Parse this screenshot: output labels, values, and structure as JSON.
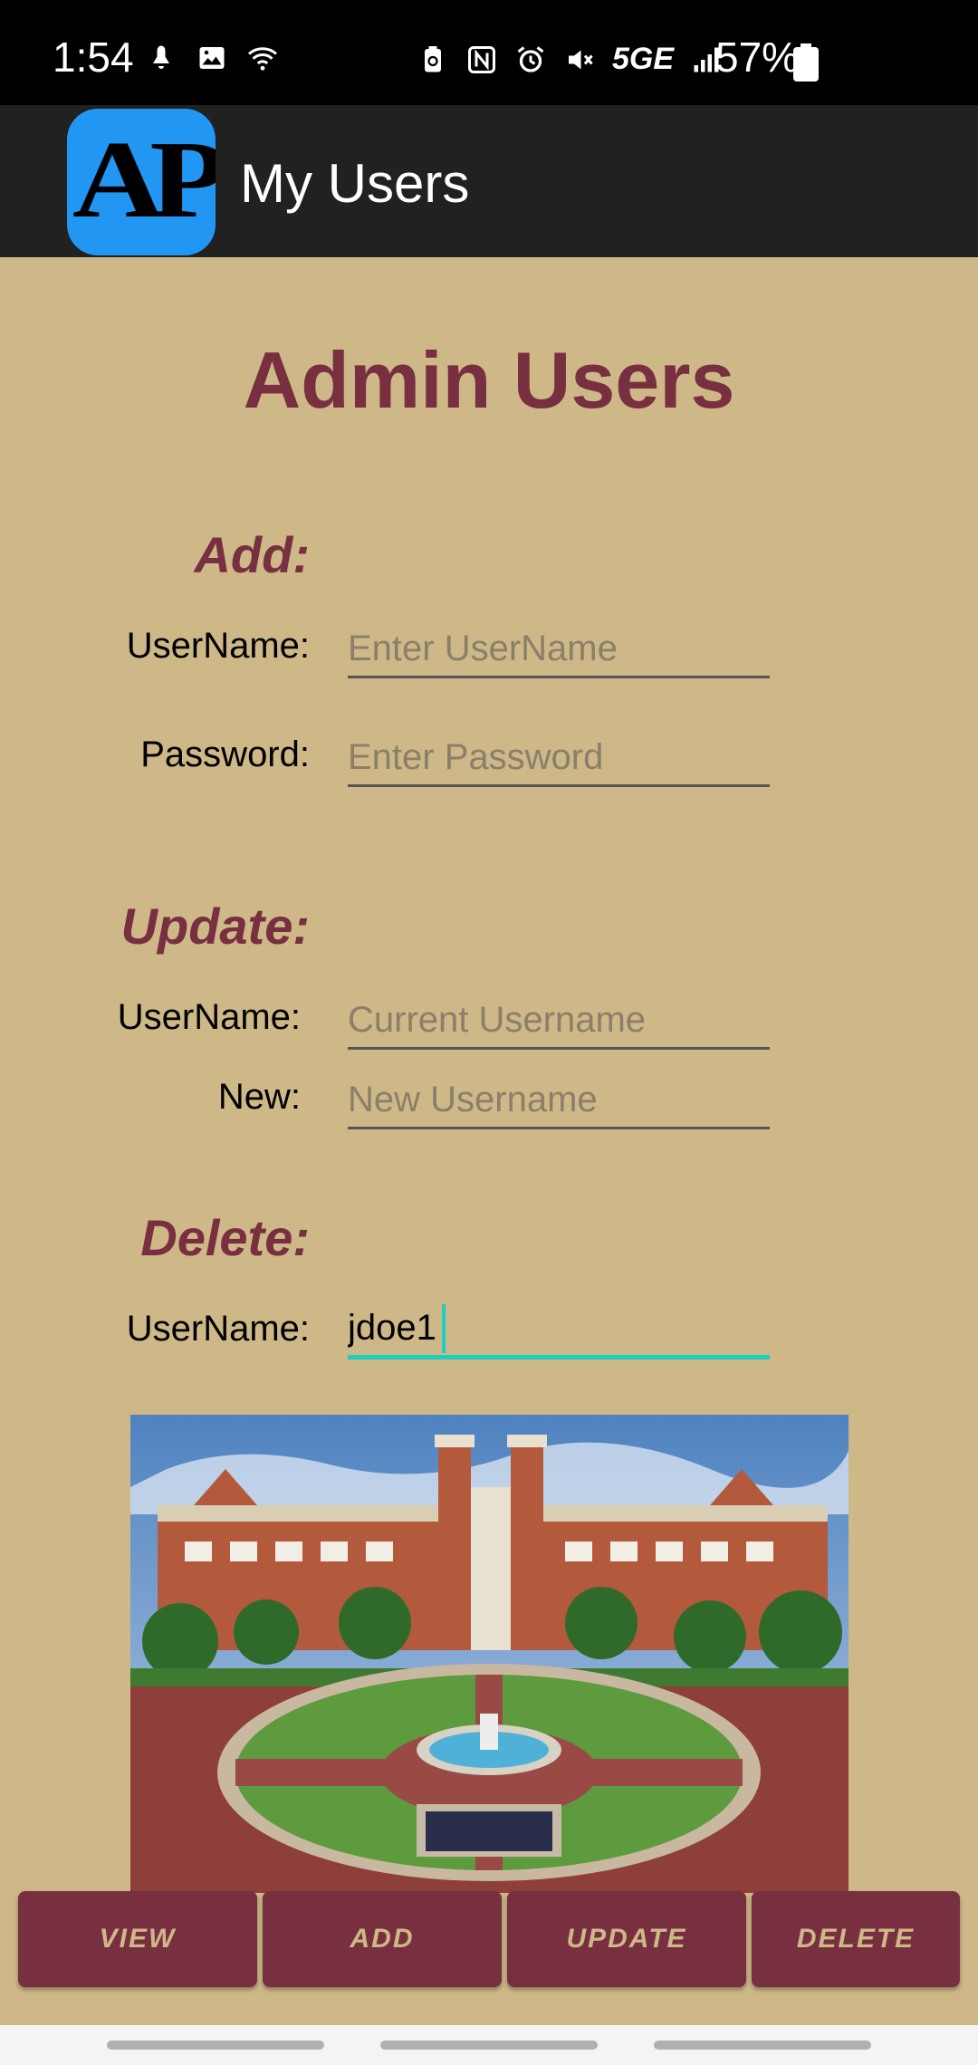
{
  "status_bar": {
    "time": "1:54",
    "battery_percent": "57%",
    "network": "5GE",
    "icons": [
      "notification-icon",
      "gallery-icon",
      "wifi-icon",
      "battery-saver-icon",
      "nfc-icon",
      "alarm-icon",
      "mute-icon",
      "network-5ge-icon",
      "signal-icon",
      "battery-icon"
    ]
  },
  "app_bar": {
    "logo_text": "AP",
    "title": "My Users"
  },
  "main": {
    "title": "Admin Users",
    "add": {
      "heading": "Add:",
      "username_label": "UserName:",
      "username_placeholder": "Enter UserName",
      "username_value": "",
      "password_label": "Password:",
      "password_placeholder": "Enter Password",
      "password_value": ""
    },
    "update": {
      "heading": "Update:",
      "username_label": "UserName:",
      "username_placeholder": "Current Username",
      "username_value": "",
      "new_label": "New:",
      "new_placeholder": "New Username",
      "new_value": ""
    },
    "delete": {
      "heading": "Delete:",
      "username_label": "UserName:",
      "username_value": "jdoe1"
    }
  },
  "buttons": {
    "view": "VIEW",
    "add": "ADD",
    "update": "UPDATE",
    "delete": "DELETE"
  },
  "colors": {
    "background": "#CEB888",
    "accent": "#782F40",
    "focus": "#1DCFC0",
    "app_bar": "#212121",
    "logo_bg": "#2196F3"
  }
}
